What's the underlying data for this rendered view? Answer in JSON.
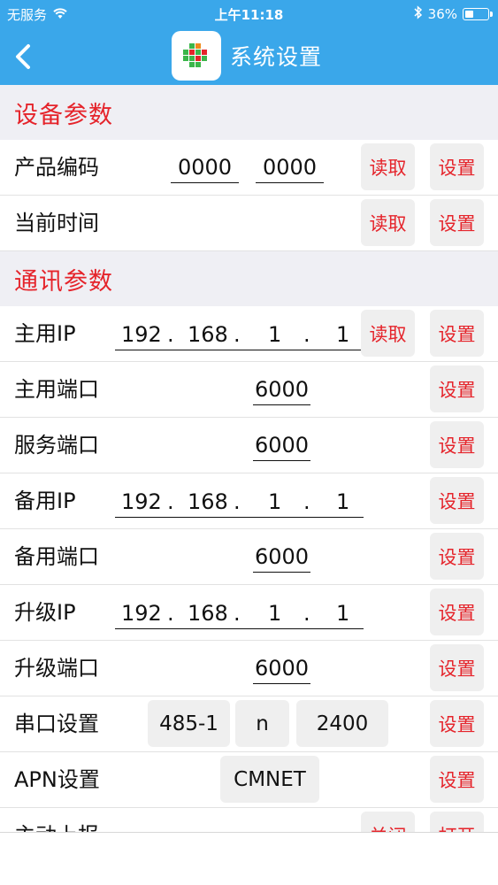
{
  "status_bar": {
    "carrier": "无服务",
    "time": "上午11:18",
    "battery": "36%",
    "battery_level": 0.36
  },
  "nav": {
    "title": "系统设置",
    "back_icon": "chevron-left-icon",
    "app_icon": "app-logo-icon"
  },
  "sections": {
    "device": {
      "title": "设备参数"
    },
    "comm": {
      "title": "通讯参数"
    }
  },
  "buttons": {
    "read": "读取",
    "set": "设置",
    "close": "关闭",
    "open": "打开"
  },
  "device_params": {
    "product_code": {
      "label": "产品编码",
      "value1": "0000",
      "value2": "0000"
    },
    "current_time": {
      "label": "当前时间"
    }
  },
  "comm_params": {
    "primary_ip": {
      "label": "主用IP",
      "ip": [
        "192",
        "168",
        "1",
        "1"
      ]
    },
    "primary_port": {
      "label": "主用端口",
      "value": "6000"
    },
    "service_port": {
      "label": "服务端口",
      "value": "6000"
    },
    "backup_ip": {
      "label": "备用IP",
      "ip": [
        "192",
        "168",
        "1",
        "1"
      ]
    },
    "backup_port": {
      "label": "备用端口",
      "value": "6000"
    },
    "upgrade_ip": {
      "label": "升级IP",
      "ip": [
        "192",
        "168",
        "1",
        "1"
      ]
    },
    "upgrade_port": {
      "label": "升级端口",
      "value": "6000"
    },
    "serial": {
      "label": "串口设置",
      "mode": "485-1",
      "parity": "n",
      "baud": "2400"
    },
    "apn": {
      "label": "APN设置",
      "value": "CMNET"
    },
    "auto_report": {
      "label": "主动上报"
    }
  },
  "ip_separator": ".",
  "colors": {
    "brand_blue": "#3aa7ea",
    "accent_red": "#e5242b",
    "section_bg": "#efeff4",
    "button_bg": "#efefef"
  }
}
